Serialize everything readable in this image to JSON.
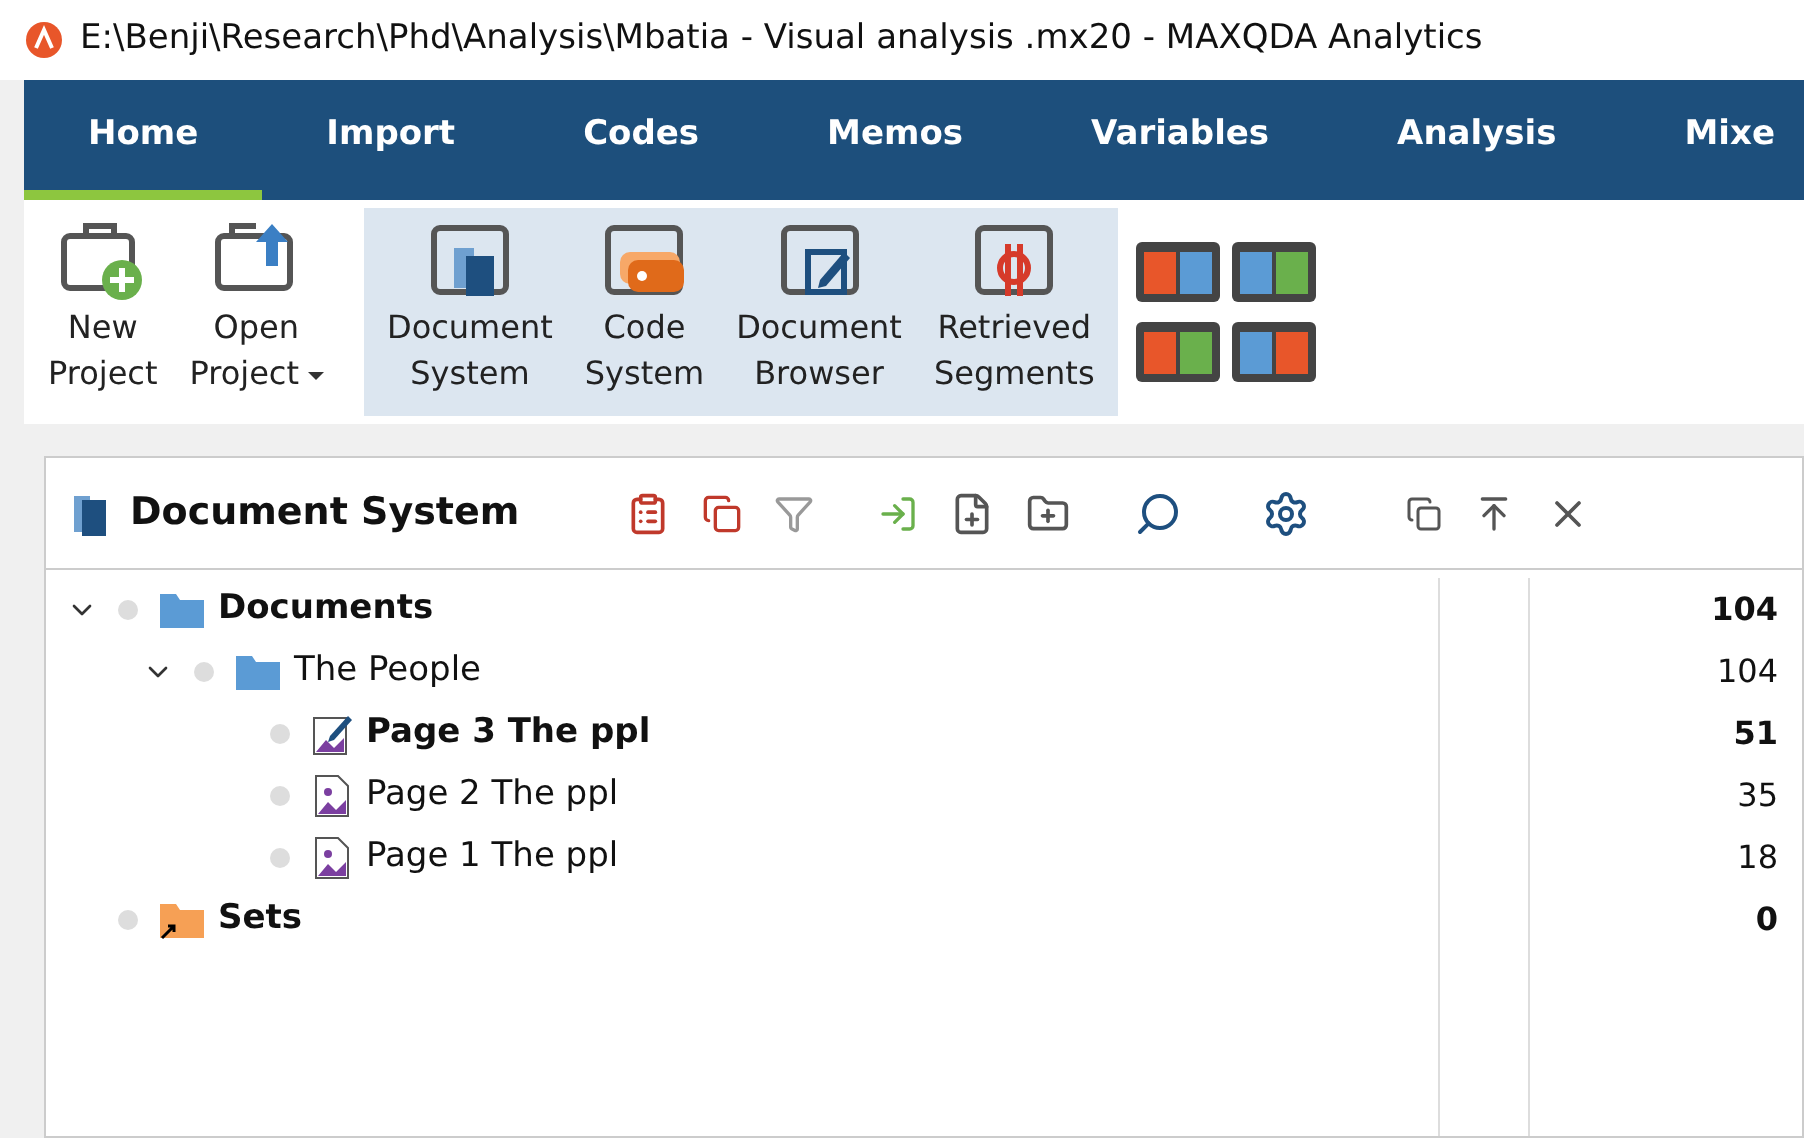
{
  "window": {
    "title": "E:\\Benji\\Research\\Phd\\Analysis\\Mbatia - Visual analysis .mx20 - MAXQDA Analytics"
  },
  "tabs": [
    {
      "label": "Home",
      "selected": true
    },
    {
      "label": "Import",
      "selected": false
    },
    {
      "label": "Codes",
      "selected": false
    },
    {
      "label": "Memos",
      "selected": false
    },
    {
      "label": "Variables",
      "selected": false
    },
    {
      "label": "Analysis",
      "selected": false
    },
    {
      "label": "Mixe",
      "selected": false
    }
  ],
  "ribbon": {
    "groups": [
      {
        "highlighted": false,
        "buttons": [
          {
            "kind": "new-project",
            "lines": [
              "New",
              "Project"
            ],
            "dropdown": false
          },
          {
            "kind": "open-project",
            "lines": [
              "Open",
              "Project"
            ],
            "dropdown": true
          }
        ]
      },
      {
        "highlighted": true,
        "buttons": [
          {
            "kind": "document-system",
            "lines": [
              "Document",
              "System"
            ],
            "dropdown": false
          },
          {
            "kind": "code-system",
            "lines": [
              "Code",
              "System"
            ],
            "dropdown": false
          },
          {
            "kind": "document-browser",
            "lines": [
              "Document",
              "Browser"
            ],
            "dropdown": false
          },
          {
            "kind": "retrieved-segments",
            "lines": [
              "Retrieved",
              "Segments"
            ],
            "dropdown": false
          }
        ]
      }
    ]
  },
  "panel": {
    "title": "Document System",
    "tree": [
      {
        "label": "Documents",
        "kind": "folder",
        "bold": true,
        "count": "104",
        "expanded": true,
        "children": [
          {
            "label": "The People",
            "kind": "folder",
            "bold": false,
            "count": "104",
            "expanded": true,
            "children": [
              {
                "label": "Page 3 The ppl",
                "kind": "edited-doc",
                "bold": true,
                "count": "51"
              },
              {
                "label": "Page 2 The ppl",
                "kind": "image-doc",
                "bold": false,
                "count": "35"
              },
              {
                "label": "Page 1 The ppl",
                "kind": "image-doc",
                "bold": false,
                "count": "18"
              }
            ]
          }
        ]
      },
      {
        "label": "Sets",
        "kind": "set",
        "bold": true,
        "count": "0"
      }
    ]
  }
}
